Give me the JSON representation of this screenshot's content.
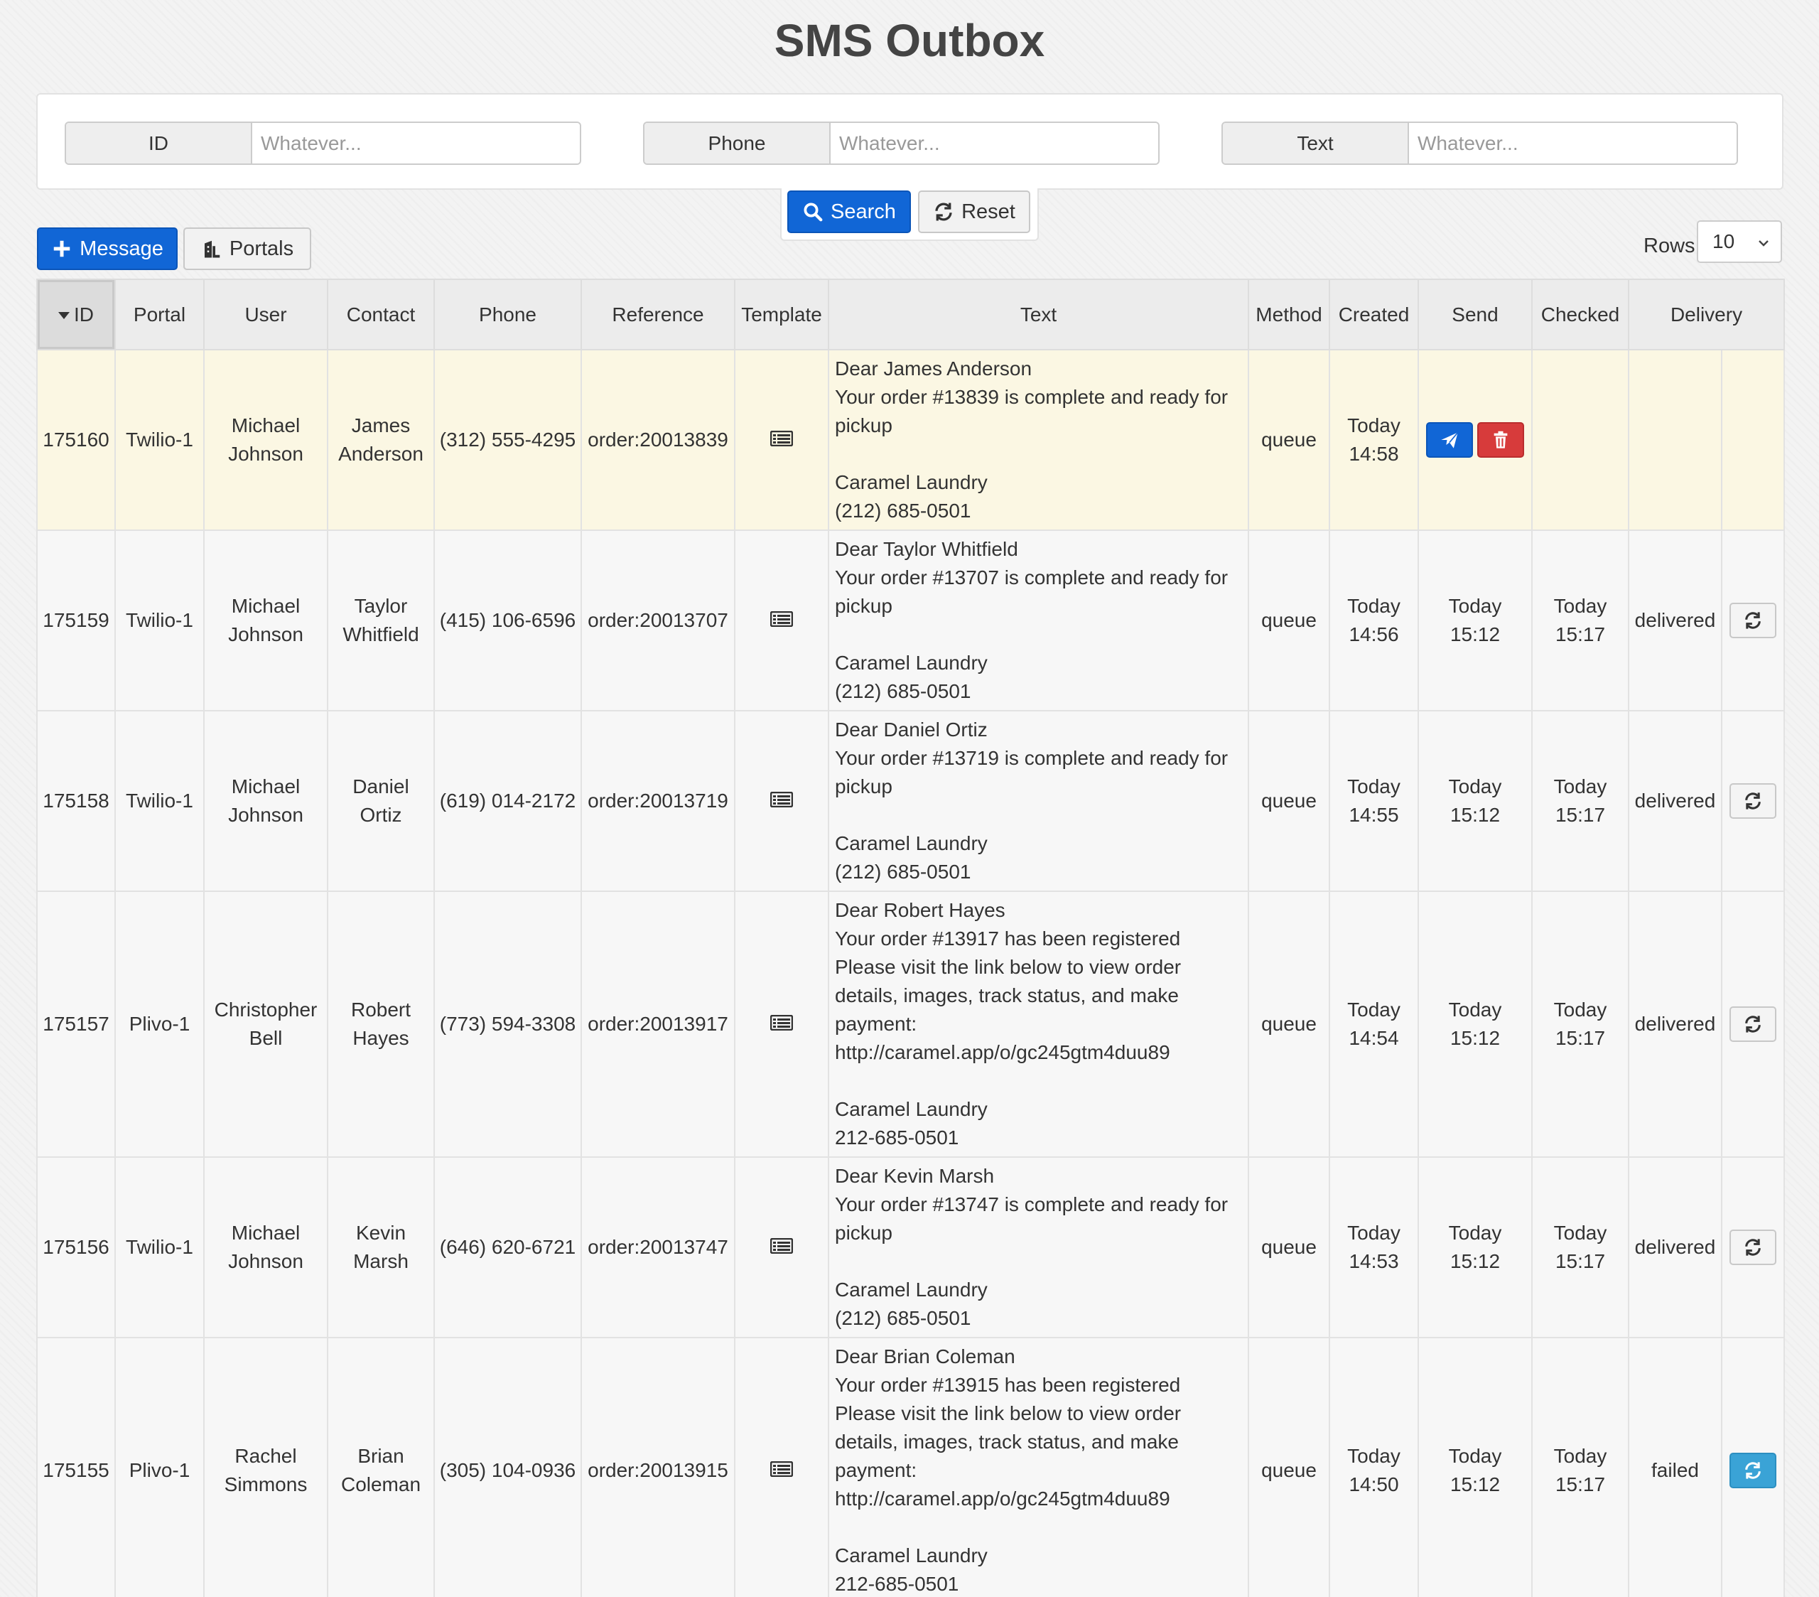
{
  "page": {
    "title": "SMS Outbox"
  },
  "filters": [
    {
      "label": "ID",
      "placeholder": "Whatever..."
    },
    {
      "label": "Phone",
      "placeholder": "Whatever..."
    },
    {
      "label": "Text",
      "placeholder": "Whatever..."
    }
  ],
  "buttons": {
    "search": "Search",
    "reset": "Reset",
    "message": "Message",
    "portals": "Portals"
  },
  "rows_selector": {
    "label": "Rows",
    "value": "10"
  },
  "table": {
    "columns": [
      "ID",
      "Portal",
      "User",
      "Contact",
      "Phone",
      "Reference",
      "Template",
      "Text",
      "Method",
      "Created",
      "Send",
      "Checked",
      "Delivery"
    ],
    "rows": [
      {
        "id": "175160",
        "portal": "Twilio-1",
        "user": "Michael\nJohnson",
        "contact": "James\nAnderson",
        "phone": "(312) 555-4295",
        "reference": "order:20013839",
        "text": "Dear James Anderson\nYour order #13839 is complete and ready for pickup\n\nCaramel Laundry\n(212) 685-0501",
        "method": "queue",
        "created": "Today\n14:58",
        "send": "",
        "checked": "",
        "delivery": "",
        "pending": true
      },
      {
        "id": "175159",
        "portal": "Twilio-1",
        "user": "Michael\nJohnson",
        "contact": "Taylor\nWhitfield",
        "phone": "(415) 106-6596",
        "reference": "order:20013707",
        "text": "Dear Taylor Whitfield\nYour order #13707 is complete and ready for pickup\n\nCaramel Laundry\n(212) 685-0501",
        "method": "queue",
        "created": "Today\n14:56",
        "send": "Today\n15:12",
        "checked": "Today\n15:17",
        "delivery": "delivered",
        "pending": false
      },
      {
        "id": "175158",
        "portal": "Twilio-1",
        "user": "Michael\nJohnson",
        "contact": "Daniel\nOrtiz",
        "phone": "(619) 014-2172",
        "reference": "order:20013719",
        "text": "Dear Daniel Ortiz\nYour order #13719 is complete and ready for pickup\n\nCaramel Laundry\n(212) 685-0501",
        "method": "queue",
        "created": "Today\n14:55",
        "send": "Today\n15:12",
        "checked": "Today\n15:17",
        "delivery": "delivered",
        "pending": false
      },
      {
        "id": "175157",
        "portal": "Plivo-1",
        "user": "Christopher\nBell",
        "contact": "Robert\nHayes",
        "phone": "(773) 594-3308",
        "reference": "order:20013917",
        "text": "Dear Robert Hayes\nYour order #13917 has been registered\nPlease visit the link below to view order details, images, track status, and make payment:\nhttp://caramel.app/o/gc245gtm4duu89\n\nCaramel Laundry\n212-685-0501",
        "method": "queue",
        "created": "Today\n14:54",
        "send": "Today\n15:12",
        "checked": "Today\n15:17",
        "delivery": "delivered",
        "pending": false
      },
      {
        "id": "175156",
        "portal": "Twilio-1",
        "user": "Michael\nJohnson",
        "contact": "Kevin\nMarsh",
        "phone": "(646) 620-6721",
        "reference": "order:20013747",
        "text": "Dear Kevin Marsh\nYour order #13747 is complete and ready for pickup\n\nCaramel Laundry\n(212) 685-0501",
        "method": "queue",
        "created": "Today\n14:53",
        "send": "Today\n15:12",
        "checked": "Today\n15:17",
        "delivery": "delivered",
        "pending": false
      },
      {
        "id": "175155",
        "portal": "Plivo-1",
        "user": "Rachel\nSimmons",
        "contact": "Brian\nColeman",
        "phone": "(305) 104-0936",
        "reference": "order:20013915",
        "text": "Dear Brian Coleman\nYour order #13915 has been registered\nPlease visit the link below to view order details, images, track status, and make payment:\nhttp://caramel.app/o/gc245gtm4duu89\n\nCaramel Laundry\n212-685-0501",
        "method": "queue",
        "created": "Today\n14:50",
        "send": "Today\n15:12",
        "checked": "Today\n15:17",
        "delivery": "failed",
        "pending": false
      }
    ]
  },
  "icons": {
    "add": "plus-icon",
    "portals": "building-icon",
    "search": "search-icon",
    "reset": "refresh-icon",
    "template": "list-icon",
    "send": "paper-plane-icon",
    "delete": "trash-icon",
    "resend": "refresh-icon",
    "dropdown": "chevron-down-icon"
  },
  "colors": {
    "primary": "#1166d6",
    "danger": "#d73b3b",
    "info": "#3aa3d6",
    "highlight": "#fbf7e3"
  }
}
